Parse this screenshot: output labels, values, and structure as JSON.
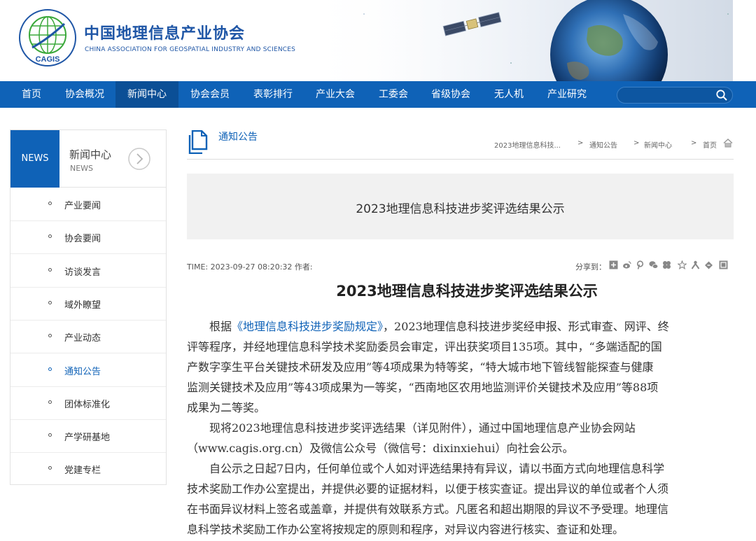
{
  "header": {
    "logo_cn": "中国地理信息产业协会",
    "logo_en": "CHINA ASSOCIATION FOR GEOSPATIAL INDUSTRY AND SCIENCES",
    "emblem_text": "CAGIS",
    "emblem_ring": "ASSOCIATION FOR GEOSPATIAL INDUSTRY AND SCIENCES"
  },
  "nav": {
    "items": [
      "首页",
      "协会概况",
      "新闻中心",
      "协会会员",
      "表彰排行",
      "产业大会",
      "工委会",
      "省级协会",
      "无人机",
      "产业研究"
    ],
    "active": "新闻中心",
    "search_placeholder": "",
    "search_icon": "search-icon"
  },
  "sidebar": {
    "badge": "NEWS",
    "title_cn": "新闻中心",
    "title_en": "NEWS",
    "items": [
      "产业要闻",
      "协会要闻",
      "访谈发言",
      "域外瞭望",
      "产业动态",
      "通知公告",
      "团体标准化",
      "产学研基地",
      "党建专栏"
    ],
    "active": "通知公告"
  },
  "main": {
    "category": "通知公告",
    "breadcrumb": [
      "2023地理信息科技...",
      "通知公告",
      "新闻中心",
      "首页"
    ],
    "breadcrumb_sep": ">",
    "title_box": "2023地理信息科技进步奖评选结果公示",
    "meta": "TIME: 2023-09-27 08:20:32 作者:",
    "share_label": "分享到：",
    "share_icons": [
      "qzone-icon",
      "weibo-icon",
      "pinterest-icon",
      "wechat-icon",
      "douban-icon",
      "star-icon",
      "renren-icon",
      "kaixin-icon",
      "more-icon"
    ],
    "article_title": "2023地理信息科技进步奖评选结果公示",
    "paragraphs": [
      [
        {
          "prefix": "　　根据",
          "em": "《地理信息科技进步奖励规定》",
          "suffix": "，2023地理信息科技进步奖经申报、形式审查、网评、终"
        },
        "评等程序，并经地理信息科学技术奖励委员会审定，评出获奖项目135项。其中，“多端适配的国",
        "产数字孪生平台关键技术研发及应用”等4项成果为特等奖，“特大城市地下管线智能探查与健康",
        "监测关键技术及应用”等43项成果为一等奖，“西南地区农用地监测评价关键技术及应用”等88项",
        "成果为二等奖。"
      ],
      [
        "　　现将2023地理信息科技进步奖评选结果（详见附件），通过中国地理信息产业协会网站",
        "（www.cagis.org.cn）及微信公众号（微信号：dixinxiehui）向社会公示。"
      ],
      [
        "　　自公示之日起7日内，任何单位或个人如对评选结果持有异议，请以书面方式向地理信息科学",
        "技术奖励工作办公室提出，并提供必要的证据材料，以便于核实查证。提出异议的单位或者个人须",
        "在书面异议材料上签名或盖章，并提供有效联系方式。凡匿名和超出期限的异议不予受理。地理信",
        "息科学技术奖励工作办公室将按规定的原则和程序，对异议内容进行核实、查证和处理。"
      ]
    ]
  },
  "colors": {
    "brand_blue": "#0f62b7",
    "nav_active": "#0b4f96",
    "emblem_green": "#3aa83a"
  }
}
